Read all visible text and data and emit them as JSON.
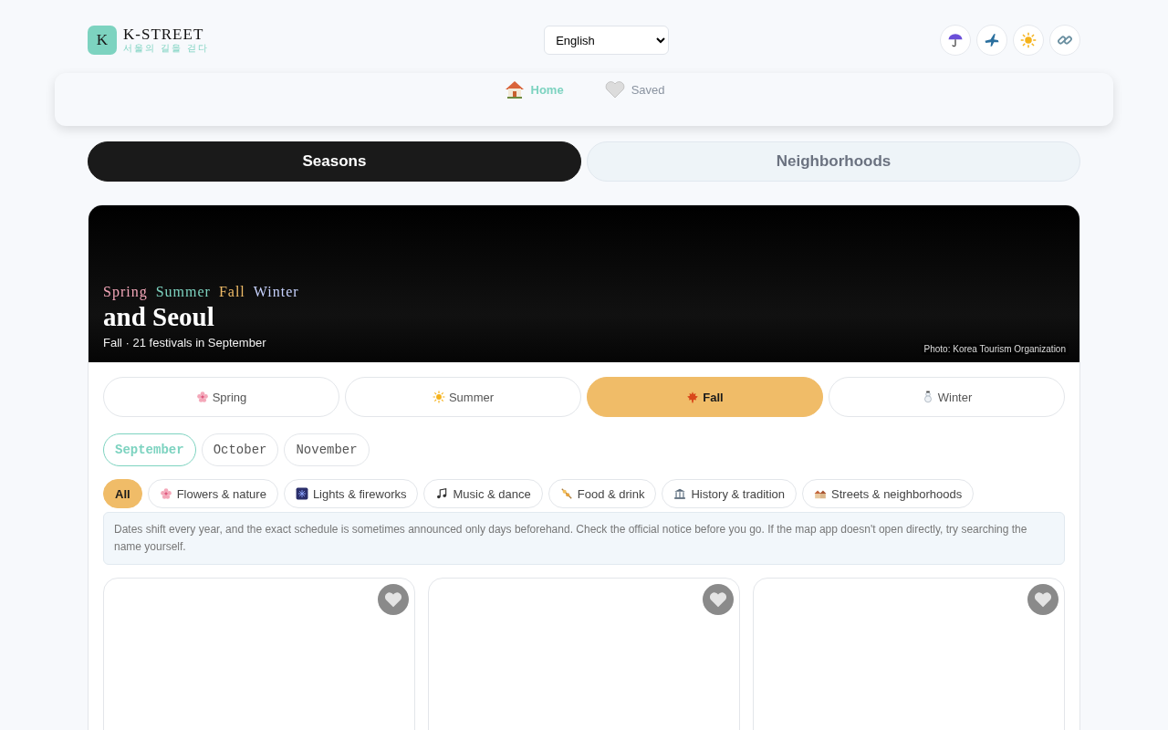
{
  "header": {
    "logo_letter": "K",
    "brand": "K-STREET",
    "tagline": "서울의 길을 걷다",
    "language": "English",
    "actions": [
      {
        "kind": "umbrella"
      },
      {
        "kind": "plane"
      },
      {
        "kind": "sun"
      },
      {
        "kind": "link"
      }
    ]
  },
  "nav": [
    {
      "label": "Home",
      "kind": "home",
      "selected": true
    },
    {
      "label": "Saved",
      "kind": "heart",
      "selected": false
    }
  ],
  "view_tabs": [
    {
      "label": "Seasons",
      "selected": true
    },
    {
      "label": "Neighborhoods",
      "selected": false
    }
  ],
  "hero": {
    "season_words": [
      {
        "text": "Spring",
        "color": "#f4a7b9"
      },
      {
        "text": "Summer",
        "color": "#7dd3c0"
      },
      {
        "text": "Fall",
        "color": "#f0bc68"
      },
      {
        "text": "Winter",
        "color": "#c7d2fe"
      }
    ],
    "title": "and Seoul",
    "subtitle": "Fall · 21 festivals in September",
    "credit": "Photo: Korea Tourism Organization"
  },
  "seasons": [
    {
      "label": "Spring",
      "kind": "flower",
      "selected": false
    },
    {
      "label": "Summer",
      "kind": "sun",
      "selected": false
    },
    {
      "label": "Fall",
      "kind": "leaf",
      "selected": true
    },
    {
      "label": "Winter",
      "kind": "snowman",
      "selected": false
    }
  ],
  "months": [
    {
      "label": "September",
      "selected": true
    },
    {
      "label": "October",
      "selected": false
    },
    {
      "label": "November",
      "selected": false
    }
  ],
  "categories": [
    {
      "label": "All",
      "kind": "none",
      "selected": true
    },
    {
      "label": "Flowers & nature",
      "kind": "flower",
      "selected": false
    },
    {
      "label": "Lights & fireworks",
      "kind": "firework",
      "selected": false
    },
    {
      "label": "Music & dance",
      "kind": "note",
      "selected": false
    },
    {
      "label": "Food & drink",
      "kind": "food",
      "selected": false
    },
    {
      "label": "History & tradition",
      "kind": "temple",
      "selected": false
    },
    {
      "label": "Streets & neighborhoods",
      "kind": "houses",
      "selected": false
    }
  ],
  "notice": "Dates shift every year, and the exact schedule is sometimes announced only days beforehand. Check the official notice before you go. If the map app doesn't open directly, try searching the name yourself.",
  "cards": [
    {
      "saved": false
    },
    {
      "saved": false
    },
    {
      "saved": false
    }
  ]
}
